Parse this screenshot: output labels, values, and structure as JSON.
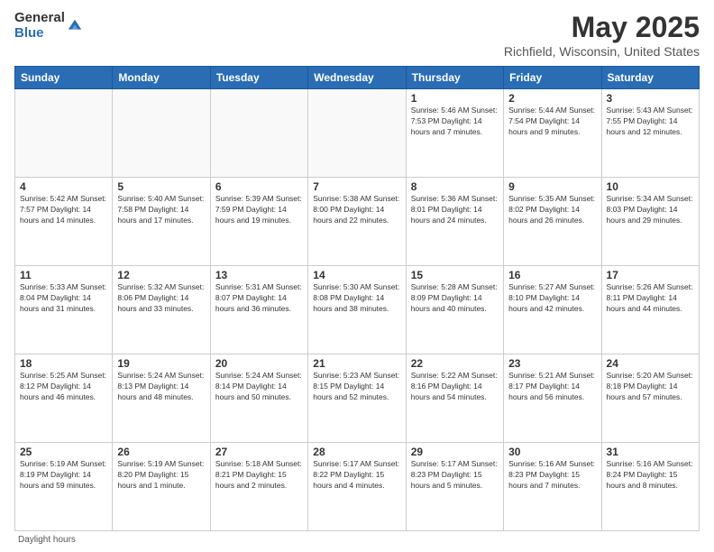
{
  "header": {
    "logo_general": "General",
    "logo_blue": "Blue",
    "month_title": "May 2025",
    "location": "Richfield, Wisconsin, United States"
  },
  "days_of_week": [
    "Sunday",
    "Monday",
    "Tuesday",
    "Wednesday",
    "Thursday",
    "Friday",
    "Saturday"
  ],
  "weeks": [
    [
      {
        "day": "",
        "info": ""
      },
      {
        "day": "",
        "info": ""
      },
      {
        "day": "",
        "info": ""
      },
      {
        "day": "",
        "info": ""
      },
      {
        "day": "1",
        "info": "Sunrise: 5:46 AM\nSunset: 7:53 PM\nDaylight: 14 hours\nand 7 minutes."
      },
      {
        "day": "2",
        "info": "Sunrise: 5:44 AM\nSunset: 7:54 PM\nDaylight: 14 hours\nand 9 minutes."
      },
      {
        "day": "3",
        "info": "Sunrise: 5:43 AM\nSunset: 7:55 PM\nDaylight: 14 hours\nand 12 minutes."
      }
    ],
    [
      {
        "day": "4",
        "info": "Sunrise: 5:42 AM\nSunset: 7:57 PM\nDaylight: 14 hours\nand 14 minutes."
      },
      {
        "day": "5",
        "info": "Sunrise: 5:40 AM\nSunset: 7:58 PM\nDaylight: 14 hours\nand 17 minutes."
      },
      {
        "day": "6",
        "info": "Sunrise: 5:39 AM\nSunset: 7:59 PM\nDaylight: 14 hours\nand 19 minutes."
      },
      {
        "day": "7",
        "info": "Sunrise: 5:38 AM\nSunset: 8:00 PM\nDaylight: 14 hours\nand 22 minutes."
      },
      {
        "day": "8",
        "info": "Sunrise: 5:36 AM\nSunset: 8:01 PM\nDaylight: 14 hours\nand 24 minutes."
      },
      {
        "day": "9",
        "info": "Sunrise: 5:35 AM\nSunset: 8:02 PM\nDaylight: 14 hours\nand 26 minutes."
      },
      {
        "day": "10",
        "info": "Sunrise: 5:34 AM\nSunset: 8:03 PM\nDaylight: 14 hours\nand 29 minutes."
      }
    ],
    [
      {
        "day": "11",
        "info": "Sunrise: 5:33 AM\nSunset: 8:04 PM\nDaylight: 14 hours\nand 31 minutes."
      },
      {
        "day": "12",
        "info": "Sunrise: 5:32 AM\nSunset: 8:06 PM\nDaylight: 14 hours\nand 33 minutes."
      },
      {
        "day": "13",
        "info": "Sunrise: 5:31 AM\nSunset: 8:07 PM\nDaylight: 14 hours\nand 36 minutes."
      },
      {
        "day": "14",
        "info": "Sunrise: 5:30 AM\nSunset: 8:08 PM\nDaylight: 14 hours\nand 38 minutes."
      },
      {
        "day": "15",
        "info": "Sunrise: 5:28 AM\nSunset: 8:09 PM\nDaylight: 14 hours\nand 40 minutes."
      },
      {
        "day": "16",
        "info": "Sunrise: 5:27 AM\nSunset: 8:10 PM\nDaylight: 14 hours\nand 42 minutes."
      },
      {
        "day": "17",
        "info": "Sunrise: 5:26 AM\nSunset: 8:11 PM\nDaylight: 14 hours\nand 44 minutes."
      }
    ],
    [
      {
        "day": "18",
        "info": "Sunrise: 5:25 AM\nSunset: 8:12 PM\nDaylight: 14 hours\nand 46 minutes."
      },
      {
        "day": "19",
        "info": "Sunrise: 5:24 AM\nSunset: 8:13 PM\nDaylight: 14 hours\nand 48 minutes."
      },
      {
        "day": "20",
        "info": "Sunrise: 5:24 AM\nSunset: 8:14 PM\nDaylight: 14 hours\nand 50 minutes."
      },
      {
        "day": "21",
        "info": "Sunrise: 5:23 AM\nSunset: 8:15 PM\nDaylight: 14 hours\nand 52 minutes."
      },
      {
        "day": "22",
        "info": "Sunrise: 5:22 AM\nSunset: 8:16 PM\nDaylight: 14 hours\nand 54 minutes."
      },
      {
        "day": "23",
        "info": "Sunrise: 5:21 AM\nSunset: 8:17 PM\nDaylight: 14 hours\nand 56 minutes."
      },
      {
        "day": "24",
        "info": "Sunrise: 5:20 AM\nSunset: 8:18 PM\nDaylight: 14 hours\nand 57 minutes."
      }
    ],
    [
      {
        "day": "25",
        "info": "Sunrise: 5:19 AM\nSunset: 8:19 PM\nDaylight: 14 hours\nand 59 minutes."
      },
      {
        "day": "26",
        "info": "Sunrise: 5:19 AM\nSunset: 8:20 PM\nDaylight: 15 hours\nand 1 minute."
      },
      {
        "day": "27",
        "info": "Sunrise: 5:18 AM\nSunset: 8:21 PM\nDaylight: 15 hours\nand 2 minutes."
      },
      {
        "day": "28",
        "info": "Sunrise: 5:17 AM\nSunset: 8:22 PM\nDaylight: 15 hours\nand 4 minutes."
      },
      {
        "day": "29",
        "info": "Sunrise: 5:17 AM\nSunset: 8:23 PM\nDaylight: 15 hours\nand 5 minutes."
      },
      {
        "day": "30",
        "info": "Sunrise: 5:16 AM\nSunset: 8:23 PM\nDaylight: 15 hours\nand 7 minutes."
      },
      {
        "day": "31",
        "info": "Sunrise: 5:16 AM\nSunset: 8:24 PM\nDaylight: 15 hours\nand 8 minutes."
      }
    ]
  ],
  "footer": {
    "daylight_label": "Daylight hours"
  }
}
